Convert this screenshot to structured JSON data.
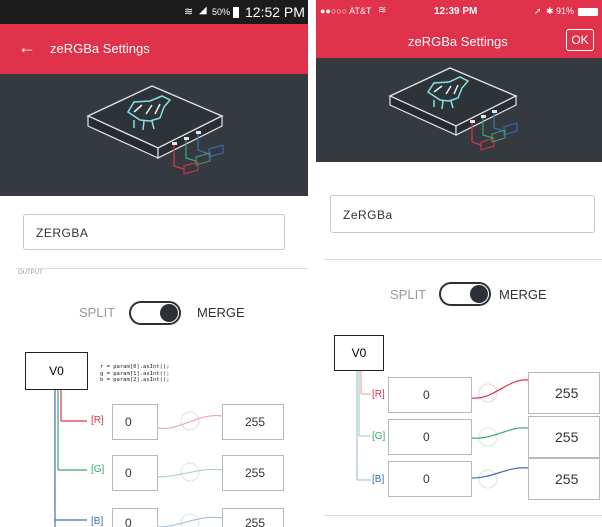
{
  "android": {
    "status": {
      "battery": "50%",
      "time": "12:52 PM"
    },
    "appbar": {
      "title": "zeRGBa Settings"
    },
    "device_name": "ZERGBA",
    "output_label": "OUTPUT",
    "mode": {
      "left": "SPLIT",
      "right": "MERGE",
      "active": "merge"
    },
    "pin": "V0",
    "code": [
      "r = param[0].asInt();",
      "g = param[1].asInt();",
      "b = param[2].asInt();"
    ],
    "channels": [
      {
        "label": "[R]",
        "min": "0",
        "max": "255",
        "color": "#e0324a"
      },
      {
        "label": "[G]",
        "min": "0",
        "max": "255",
        "color": "#3aa66a"
      },
      {
        "label": "[B]",
        "min": "0",
        "max": "255",
        "color": "#3b6fb5"
      }
    ]
  },
  "ios": {
    "status": {
      "carrier": "●●○○○ AT&T",
      "time": "12:39 PM",
      "battery": "91%"
    },
    "appbar": {
      "title": "zeRGBa Settings",
      "ok": "OK"
    },
    "device_name": "ZeRGBa",
    "mode": {
      "left": "SPLIT",
      "right": "MERGE",
      "active": "merge"
    },
    "pin": "V0",
    "channels": [
      {
        "label": "[R]",
        "min": "0",
        "max": "255",
        "color": "#e0324a"
      },
      {
        "label": "[G]",
        "min": "0",
        "max": "255",
        "color": "#3aa66a"
      },
      {
        "label": "[B]",
        "min": "0",
        "max": "255",
        "color": "#3b6fb5"
      }
    ]
  },
  "colors": {
    "accent": "#e0324a",
    "hero_bg": "#353a40",
    "dark": "#2d3136"
  }
}
